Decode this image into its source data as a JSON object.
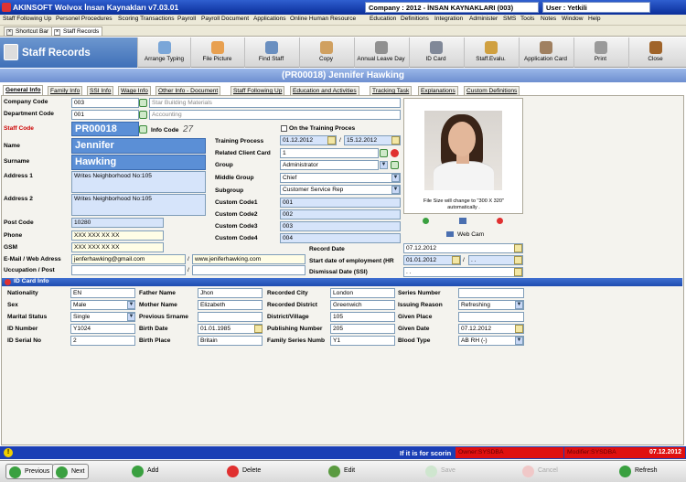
{
  "window": {
    "title": "AKINSOFT Wolvox İnsan Kaynakları v7.03.01",
    "company": "Company : 2012 - İNSAN KAYNAKLARI (003)",
    "user": "User : Yetkili"
  },
  "menu": [
    "Staff Following Up",
    "Personel Procedures",
    "Scoring Transactions",
    "Payroll",
    "Payroll Document",
    "Applications",
    "Online Human Resource",
    "Education",
    "Definitions",
    "Integration",
    "Administer",
    "SMS",
    "Tools",
    "Notes",
    "Window",
    "Help"
  ],
  "doc_tabs": [
    "Shortcut Bar",
    "Staff Records"
  ],
  "header": {
    "title": "Staff Records"
  },
  "toolbar": [
    "Arrange Typing",
    "File Picture",
    "Find Staff",
    "Copy",
    "Annual Leave Day",
    "ID Card",
    "Staff.Evalu.",
    "Application Card",
    "Print",
    "Close"
  ],
  "record_title": "(PR00018) Jennifer Hawking",
  "form_tabs": [
    "General Info",
    "Family Info",
    "SSI Info",
    "Wage Info",
    "Other Info - Document",
    "Staff Following Up",
    "Education and Activities",
    "Tracking Task",
    "Explanations",
    "Custom Definitions"
  ],
  "labels": {
    "company_code": "Company Code",
    "department_code": "Department Code",
    "staff_code": "Staff Code",
    "info_code": "Info Code",
    "name": "Name",
    "surname": "Surname",
    "address1": "Address 1",
    "address2": "Address 2",
    "post_code": "Post Code",
    "phone": "Phone",
    "gsm": "GSM",
    "email_web": "E-Mail / Web Adress",
    "occupation": "Uccupation / Post",
    "on_training": "On the Training Proces",
    "training_process": "Training Process",
    "related_client": "Related Client Card",
    "group": "Group",
    "middle_group": "Middle Group",
    "subgroup": "Subgroup",
    "cc1": "Custom Code1",
    "cc2": "Custom Code2",
    "cc3": "Custom Code3",
    "cc4": "Custom Code4",
    "record_date": "Record Date",
    "start_date": "Start date of employment (HR",
    "dismissal_date": "Dismissal Date (SSI)",
    "photo_note": "File Size will change to \"300 X 320\" automatically .",
    "webcam": "Web Cam"
  },
  "values": {
    "company_code": "003",
    "company_name": "Star Building Materials",
    "department_code": "001",
    "department_name": "Accounting",
    "staff_code": "PR00018",
    "info_code": "27",
    "name": "Jennifer",
    "surname": "Hawking",
    "address1": "Writes Neighborhood No:105",
    "address2": "Writes Neighborhood No:105",
    "post_code": "10280",
    "phone": "XXX XXX XX XX",
    "gsm": "XXX XXX XX XX",
    "email": "jenferhawking@gmail.com",
    "web": "www.jeniferhawking.com",
    "training_from": "01.12.2012",
    "training_to": "15.12.2012",
    "related_client": "1",
    "group": "Administrator",
    "middle_group": "Chief",
    "subgroup": "Customer Service Rep",
    "cc1": "001",
    "cc2": "002",
    "cc3": "003",
    "cc4": "004",
    "record_date": "07.12.2012",
    "start_date": "01.01.2012",
    "start_date2": ". .",
    "dismissal_date": ". .",
    "slash": "/"
  },
  "id_card": {
    "title": "ID Card Info",
    "labels": {
      "nationality": "Nationality",
      "sex": "Sex",
      "marital": "Marital Status",
      "id_number": "ID Number",
      "id_serial": "ID Serial No",
      "father": "Father Name",
      "mother": "Mother Name",
      "prev_surname": "Previous Srname",
      "birth_date": "Birth Date",
      "birth_place": "Birth Place",
      "rec_city": "Recorded City",
      "rec_district": "Recorded District",
      "district": "District/Village",
      "pub_number": "Publishing Number",
      "family_series": "Family Series Numb",
      "series_number": "Series Number",
      "issuing_reason": "Issuing Reason",
      "given_place": "Given Place",
      "given_date": "Given Date",
      "blood_type": "Blood Type"
    },
    "values": {
      "nationality": "EN",
      "sex": "Male",
      "marital": "Single",
      "id_number": "Y1024",
      "id_serial": "2",
      "father": "Jhon",
      "mother": "Elizabeth",
      "prev_surname": "",
      "birth_date": "01.01.1985",
      "birth_place": "Britain",
      "rec_city": "London",
      "rec_district": "Greenwich",
      "district": "105",
      "pub_number": "205",
      "family_series": "Y1",
      "series_number": "",
      "issuing_reason": "Refreshing",
      "given_place": "",
      "given_date": "07.12.2012",
      "blood_type": "AB RH (-)"
    }
  },
  "status": {
    "scroll_text": "If it is for scorin",
    "owner": "Owner:SYSDBA",
    "modifier": "Modifier:SYSDBA",
    "date": "07.12.2012"
  },
  "bottom": {
    "previous": "Previous",
    "next": "Next",
    "add": "Add",
    "delete": "Delete",
    "edit": "Edit",
    "save": "Save",
    "cancel": "Cancel",
    "refresh": "Refresh"
  },
  "colors": {
    "accent": "#1b3fb5",
    "highlight_field": "#5b8fd6",
    "status_red": "#e01010"
  }
}
